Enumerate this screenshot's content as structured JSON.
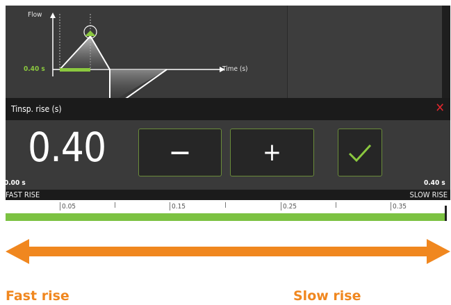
{
  "graph": {
    "y_axis_label": "Flow",
    "x_axis_label": "Time (s)",
    "rise_label": "0.40 s"
  },
  "dialog": {
    "title": "Tinsp. rise (s)",
    "close_glyph": "✕",
    "value": "0.40",
    "minus_glyph": "−",
    "plus_glyph": "+",
    "min_value_label": "0.00 s",
    "max_value_label": "0.40 s"
  },
  "slider": {
    "left_label": "FAST RISE",
    "right_label": "SLOW RISE",
    "ticks": [
      "0.05",
      "0.15",
      "0.25",
      "0.35"
    ],
    "position_fraction": 1.0,
    "track_color": "#7cc242"
  },
  "caption": {
    "fast": "Fast rise",
    "slow": "Slow rise",
    "arrow_color": "#f0871f"
  },
  "colors": {
    "accent_green": "#8bc83f",
    "close_red": "#e0262d",
    "panel_bg": "#3a3a3a"
  }
}
